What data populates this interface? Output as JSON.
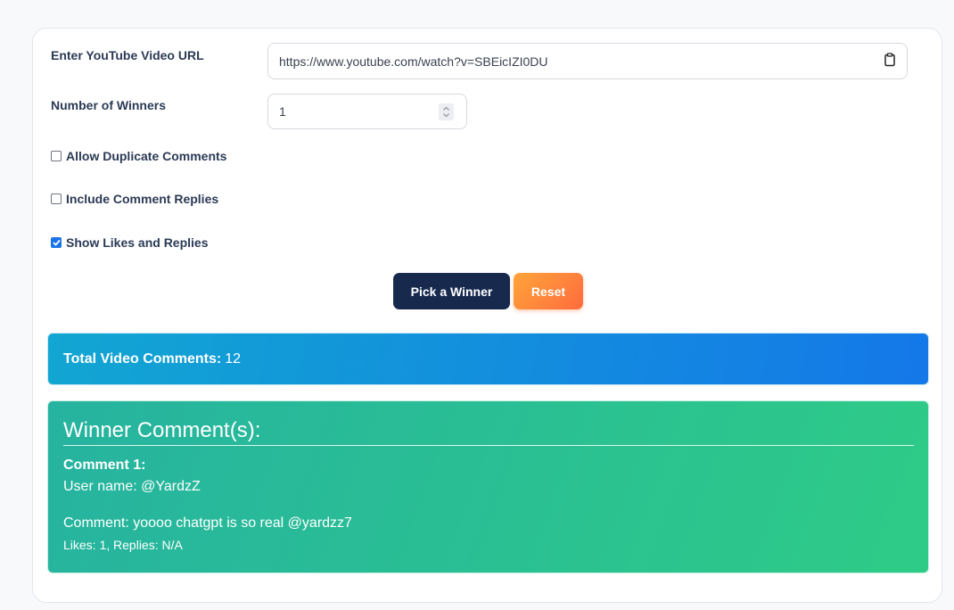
{
  "form": {
    "url_label": "Enter YouTube Video URL",
    "url_value": "https://www.youtube.com/watch?v=SBEicIZI0DU",
    "url_icon": "clipboard-icon",
    "winners_label": "Number of Winners",
    "winners_value": "1",
    "options": [
      {
        "label": "Allow Duplicate Comments",
        "checked": false
      },
      {
        "label": "Include Comment Replies",
        "checked": false
      },
      {
        "label": "Show Likes and Replies",
        "checked": true
      }
    ]
  },
  "buttons": {
    "pick": "Pick a Winner",
    "reset": "Reset"
  },
  "total": {
    "label": "Total Video Comments:",
    "value": "12"
  },
  "winners": {
    "title": "Winner Comment(s):",
    "comments": [
      {
        "heading": "Comment 1:",
        "user": "User name: @YardzZ",
        "text": "Comment: yoooo chatgpt is so real @yardzz7",
        "stats": "Likes: 1, Replies: N/A"
      }
    ]
  },
  "colors": {
    "primary_button": "#172a4e",
    "reset_gradient": [
      "#ffa53a",
      "#ff6b3d"
    ],
    "total_gradient": [
      "#12a6d2",
      "#1478e8"
    ],
    "winner_gradient": [
      "#26b3a0",
      "#2ecb87"
    ],
    "checkbox_checked": "#1a73e8"
  }
}
